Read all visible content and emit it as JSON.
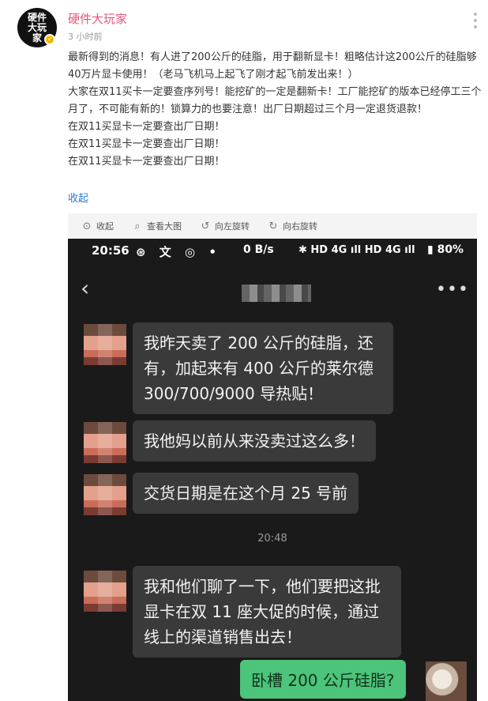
{
  "post": {
    "avatar_text": "硬件大玩家",
    "avatar_badge": "✓",
    "username": "硬件大玩家",
    "time": "3 小时前",
    "paragraphs": [
      "最新得到的消息！有人进了200公斤的硅脂，用于翻新显卡！粗略估计这200公斤的硅脂够40万片显卡使用！（老马飞机马上起飞了刚才起飞前发出来！）",
      "大家在双11买卡一定要查序列号！能挖矿的一定是翻新卡！工厂能挖矿的版本已经停工三个月了，不可能有新的！锁算力的也要注意！出厂日期超过三个月一定退货退款！",
      "在双11买显卡一定要查出厂日期！",
      "在双11买显卡一定要查出厂日期！",
      "在双11买显卡一定要查出厂日期！"
    ],
    "collapse_label": "收起"
  },
  "toolbar": {
    "items": [
      {
        "icon": "collapse-icon",
        "glyph": "⊙",
        "label": "收起"
      },
      {
        "icon": "search-icon",
        "glyph": "⌕",
        "label": "查看大图"
      },
      {
        "icon": "rotate-left-icon",
        "glyph": "↺",
        "label": "向左旋转"
      },
      {
        "icon": "rotate-right-icon",
        "glyph": "↻",
        "label": "向右旋转"
      }
    ]
  },
  "phone": {
    "status": {
      "time": "20:56",
      "icons_left": "⊛ 文 ◎ •",
      "speed": "0 B/s",
      "right": "✱ HD 4G ıll HD 4G ıll",
      "battery": "▮ 80%"
    },
    "header": {
      "back": "‹",
      "more": "•••"
    },
    "messages": [
      {
        "side": "left",
        "text": "我昨天卖了 200 公斤的硅脂，还有，加起来有 400 公斤的莱尔德 300/700/9000 导热贴！"
      },
      {
        "side": "left",
        "text": "我他妈以前从来没卖过这么多！"
      },
      {
        "side": "left",
        "text": "交货日期是在这个月 25 号前"
      },
      {
        "side": "time",
        "text": "20:48"
      },
      {
        "side": "left",
        "text": "我和他们聊了一下，他们要把这批显卡在双 11 座大促的时候，通过线上的渠道销售出去！"
      },
      {
        "side": "right",
        "text": "卧槽 200 公斤硅脂?"
      }
    ]
  }
}
